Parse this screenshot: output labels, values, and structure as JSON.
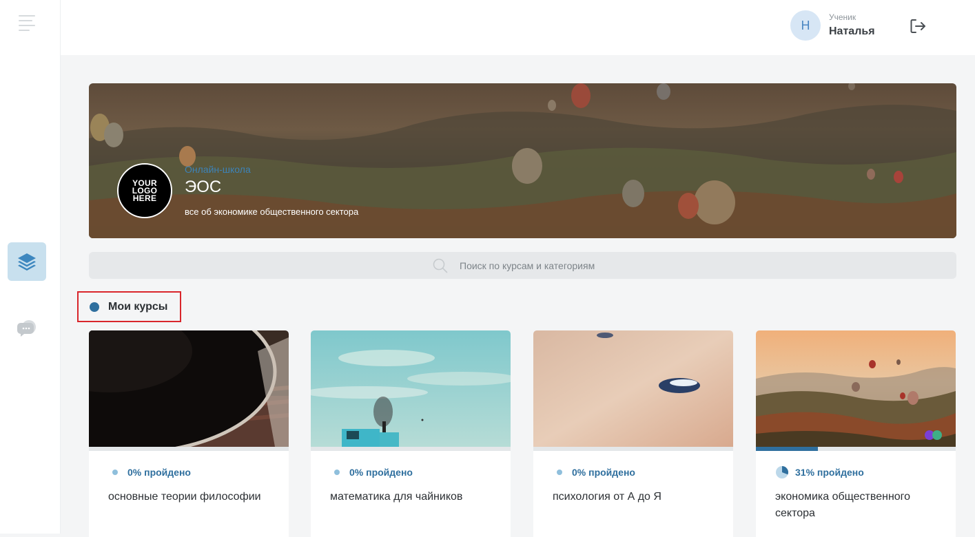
{
  "user": {
    "initial": "Н",
    "role": "Ученик",
    "name": "Наталья"
  },
  "school": {
    "logo_text": "YOUR LOGO HERE",
    "label": "Онлайн-школа",
    "name": "ЭОС",
    "description": "все об экономике общественного сектора"
  },
  "search": {
    "placeholder": "Поиск по курсам и категориям"
  },
  "section": {
    "title": "Мои курсы"
  },
  "courses": [
    {
      "title": "основные теории философии",
      "progress_label": "0% пройдено",
      "progress": 0
    },
    {
      "title": "математика для чайников",
      "progress_label": "0% пройдено",
      "progress": 0
    },
    {
      "title": "психология от А до Я",
      "progress_label": "0% пройдено",
      "progress": 0
    },
    {
      "title": "экономика общественного сектора",
      "progress_label": "31% пройдено",
      "progress": 0.31
    }
  ],
  "icons": {
    "menu": "hamburger-menu-icon",
    "courses": "layers-icon",
    "chat": "chat-bubble-icon",
    "logout": "logout-icon",
    "search": "search-icon"
  },
  "colors": {
    "accent": "#2f6f9e",
    "active_nav_bg": "#c8e0ee",
    "highlight_border": "#d9252b"
  }
}
